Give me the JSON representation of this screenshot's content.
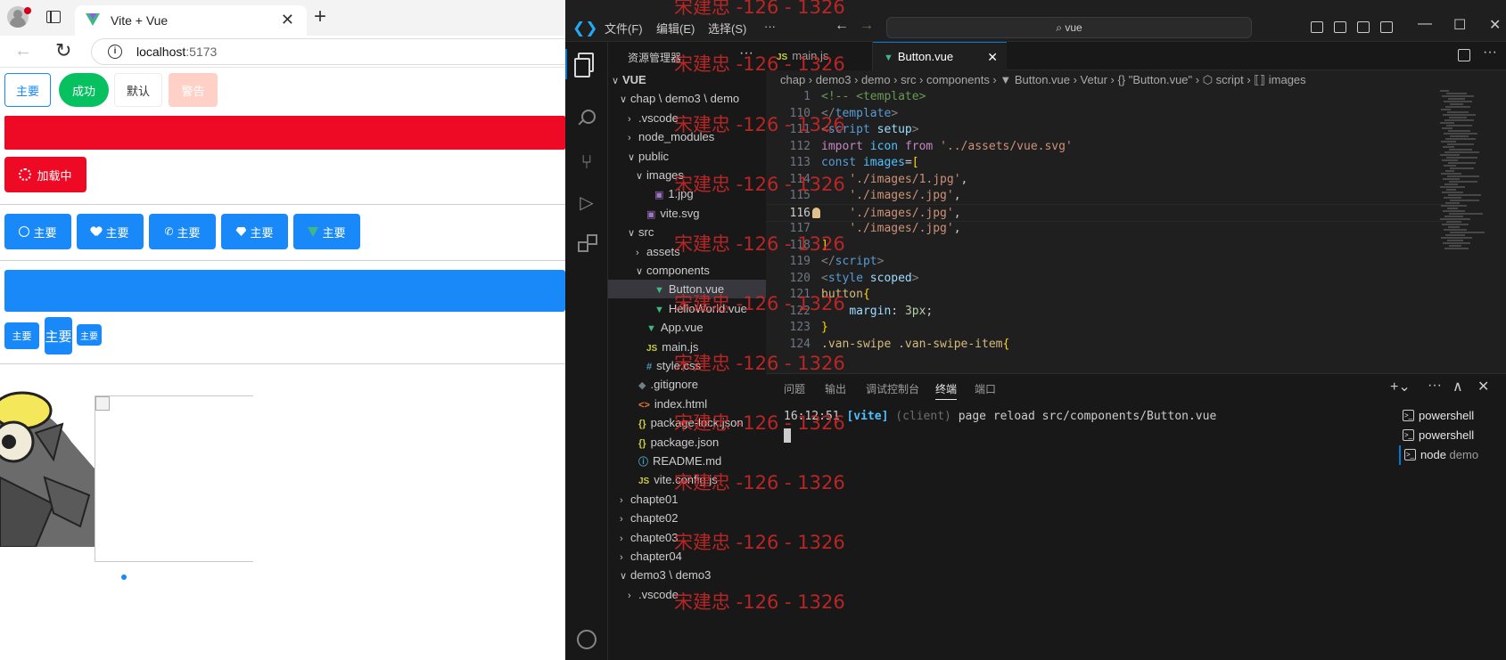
{
  "browser": {
    "tab_title": "Vite + Vue",
    "tab_close": "✕",
    "new_tab": "+",
    "url_host": "localhost",
    "url_port": ":5173",
    "row1": {
      "primary_plain": "主要",
      "success": "成功",
      "default": "默认",
      "warning": "警告"
    },
    "loading_label": "加载中",
    "icon_buttons": [
      "主要",
      "主要",
      "主要",
      "主要",
      "主要"
    ],
    "size_buttons": {
      "small": "主要",
      "large": "主要",
      "mini": "主要"
    },
    "colors": {
      "primary": "#1989fa",
      "success": "#07c160",
      "danger": "#ee0a24",
      "warning_disabled": "#ffd0c6"
    }
  },
  "vscode": {
    "menu": [
      "文件(F)",
      "编辑(E)",
      "选择(S)",
      "···"
    ],
    "search": "vue",
    "explorer_title": "资源管理器",
    "tree": [
      {
        "label": "VUE",
        "indent": 0,
        "chev": "∨",
        "icon": "",
        "bold": true
      },
      {
        "label": "chap \\ demo3 \\ demo",
        "indent": 1,
        "chev": "∨",
        "icon": ""
      },
      {
        "label": ".vscode",
        "indent": 2,
        "chev": "›",
        "icon": ""
      },
      {
        "label": "node_modules",
        "indent": 2,
        "chev": "›",
        "icon": ""
      },
      {
        "label": "public",
        "indent": 2,
        "chev": "∨",
        "icon": ""
      },
      {
        "label": "images",
        "indent": 3,
        "chev": "∨",
        "icon": ""
      },
      {
        "label": "1.jpg",
        "indent": 4,
        "chev": "",
        "icon": "img"
      },
      {
        "label": "vite.svg",
        "indent": 3,
        "chev": "",
        "icon": "img"
      },
      {
        "label": "src",
        "indent": 2,
        "chev": "∨",
        "icon": ""
      },
      {
        "label": "assets",
        "indent": 3,
        "chev": "›",
        "icon": ""
      },
      {
        "label": "components",
        "indent": 3,
        "chev": "∨",
        "icon": ""
      },
      {
        "label": "Button.vue",
        "indent": 4,
        "chev": "",
        "icon": "vue",
        "selected": true
      },
      {
        "label": "HelloWorld.vue",
        "indent": 4,
        "chev": "",
        "icon": "vue"
      },
      {
        "label": "App.vue",
        "indent": 3,
        "chev": "",
        "icon": "vue"
      },
      {
        "label": "main.js",
        "indent": 3,
        "chev": "",
        "icon": "js"
      },
      {
        "label": "style.css",
        "indent": 3,
        "chev": "",
        "icon": "css"
      },
      {
        "label": ".gitignore",
        "indent": 2,
        "chev": "",
        "icon": "git"
      },
      {
        "label": "index.html",
        "indent": 2,
        "chev": "",
        "icon": "html"
      },
      {
        "label": "package-lock.json",
        "indent": 2,
        "chev": "",
        "icon": "json"
      },
      {
        "label": "package.json",
        "indent": 2,
        "chev": "",
        "icon": "json"
      },
      {
        "label": "README.md",
        "indent": 2,
        "chev": "",
        "icon": "info"
      },
      {
        "label": "vite.config.js",
        "indent": 2,
        "chev": "",
        "icon": "js"
      },
      {
        "label": "chapte01",
        "indent": 1,
        "chev": "›",
        "icon": ""
      },
      {
        "label": "chapte02",
        "indent": 1,
        "chev": "›",
        "icon": ""
      },
      {
        "label": "chapte03",
        "indent": 1,
        "chev": "›",
        "icon": ""
      },
      {
        "label": "chapter04",
        "indent": 1,
        "chev": "›",
        "icon": ""
      },
      {
        "label": "demo3 \\ demo3",
        "indent": 1,
        "chev": "∨",
        "icon": ""
      },
      {
        "label": ".vscode",
        "indent": 2,
        "chev": "›",
        "icon": ""
      }
    ],
    "tabs": [
      {
        "label": "main.js",
        "icon": "JS",
        "active": false
      },
      {
        "label": "Button.vue",
        "icon": "▼",
        "active": true
      }
    ],
    "breadcrumb": "chap  ›  demo3  ›  demo  ›  src  ›  components  ›  ▼ Button.vue  ›  Vetur  ›  {} \"Button.vue\"  ›  ⬡ script  ›  ⟦⟧ images",
    "code": [
      {
        "ln": "1",
        "html": "<span class='t-cm'>&lt;!-- &lt;template&gt;</span>"
      },
      {
        "ln": "110",
        "html": "<span class='t-tag'>&lt;/</span><span class='t-tagn'>template</span><span class='t-tag'>&gt;</span>"
      },
      {
        "ln": "111",
        "html": "<span class='t-tag'>&lt;</span><span class='t-tagn'>script</span> <span class='t-attr'>setup</span><span class='t-tag'>&gt;</span>"
      },
      {
        "ln": "112",
        "html": "<span class='t-kw'>import</span> <span class='t-var'>icon</span> <span class='t-kw'>from</span> <span class='t-str'>'../assets/vue.svg'</span>"
      },
      {
        "ln": "113",
        "html": "<span class='t-decl'>const</span> <span class='t-var'>images</span><span class='t-pl'>=</span><span class='t-br'>[</span>"
      },
      {
        "ln": "114",
        "html": "    <span class='t-str'>'./images/1.jpg'</span><span class='t-pl'>,</span>"
      },
      {
        "ln": "115",
        "html": "    <span class='t-str'>'./images/.jpg'</span><span class='t-pl'>,</span>"
      },
      {
        "ln": "116",
        "html": "    <span class='t-str'>'./images/.jpg'</span><span class='t-pl'>,</span>",
        "current": true
      },
      {
        "ln": "117",
        "html": "    <span class='t-str'>'./images/.jpg'</span><span class='t-pl'>,</span>"
      },
      {
        "ln": "118",
        "html": "<span class='t-br'>]</span>"
      },
      {
        "ln": "119",
        "html": "<span class='t-tag'>&lt;/</span><span class='t-tagn'>script</span><span class='t-tag'>&gt;</span>"
      },
      {
        "ln": "120",
        "html": "<span class='t-tag'>&lt;</span><span class='t-tagn'>style</span> <span class='t-attr'>scoped</span><span class='t-tag'>&gt;</span>"
      },
      {
        "ln": "121",
        "html": "<span class='t-sel'>button</span><span class='t-br'>{</span>"
      },
      {
        "ln": "122",
        "html": "    <span class='t-prop'>margin</span><span class='t-pl'>: </span><span class='t-num'>3px</span><span class='t-pl'>;</span>"
      },
      {
        "ln": "123",
        "html": "<span class='t-br'>}</span>"
      },
      {
        "ln": "124",
        "html": "<span class='t-sel'>.van-swipe .van-swipe-item</span><span class='t-br'>{</span>"
      }
    ],
    "panel_tabs": [
      "问题",
      "输出",
      "调试控制台",
      "终端",
      "端口"
    ],
    "terminal_time": "16:12:51",
    "terminal_tag": "[vite]",
    "terminal_client": "(client)",
    "terminal_msg": "page reload src/components/Button.vue",
    "terminals": [
      {
        "label": "powershell",
        "sub": ""
      },
      {
        "label": "powershell",
        "sub": ""
      },
      {
        "label": "node",
        "sub": "demo"
      }
    ]
  },
  "watermark": {
    "text": "宋建忠 -126 - 1326"
  }
}
